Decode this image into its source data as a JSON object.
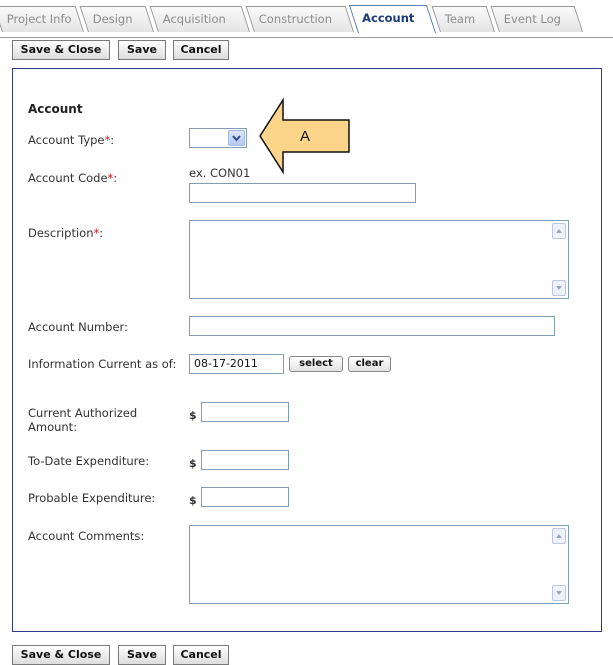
{
  "tabs": [
    {
      "label": "Project Info"
    },
    {
      "label": "Design"
    },
    {
      "label": "Acquisition"
    },
    {
      "label": "Construction"
    },
    {
      "label": "Account",
      "active": true
    },
    {
      "label": "Team"
    },
    {
      "label": "Event Log"
    }
  ],
  "toolbar": {
    "save_close": "Save & Close",
    "save": "Save",
    "cancel": "Cancel"
  },
  "form": {
    "section_title": "Account",
    "required_marker": "*",
    "account_type": {
      "label": "Account Type",
      "suffix": ":",
      "value": ""
    },
    "account_code": {
      "label": "Account Code",
      "suffix": ":",
      "hint": "ex. CON01",
      "value": ""
    },
    "description": {
      "label": "Description",
      "suffix": ":",
      "value": ""
    },
    "account_number": {
      "label": "Account Number:",
      "value": ""
    },
    "info_current": {
      "label": "Information Current as of:",
      "value": "08-17-2011",
      "select_label": "select",
      "clear_label": "clear"
    },
    "current_authorized": {
      "label": "Current Authorized Amount:",
      "currency": "$",
      "value": ""
    },
    "to_date": {
      "label": "To-Date Expenditure:",
      "currency": "$",
      "value": ""
    },
    "probable": {
      "label": "Probable Expenditure:",
      "currency": "$",
      "value": ""
    },
    "comments": {
      "label": "Account Comments:",
      "value": ""
    }
  },
  "annotation": {
    "label": "A"
  },
  "colors": {
    "panel_border": "#2e3a8c",
    "required": "#d01818",
    "callout_fill": "#fdd58a",
    "active_tab_text": "#1b3a7a"
  }
}
